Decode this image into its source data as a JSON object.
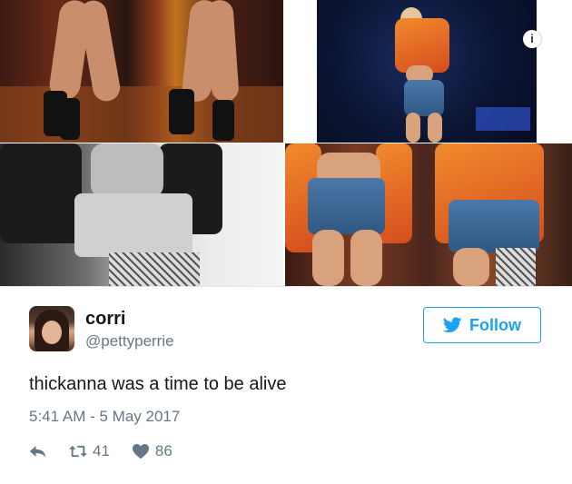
{
  "media": {
    "info_label": "i"
  },
  "tweet": {
    "display_name": "corri",
    "handle": "@pettyperrie",
    "follow_label": "Follow",
    "text": "thickanna was a time to be alive",
    "timestamp": "5:41 AM - 5 May 2017",
    "retweet_count": "41",
    "like_count": "86"
  },
  "colors": {
    "accent": "#1da1f2",
    "text": "#14171a",
    "muted": "#657786"
  },
  "icons": {
    "reply": "reply-icon",
    "retweet": "retweet-icon",
    "like": "heart-icon",
    "follow": "twitter-bird-icon",
    "info": "info-icon"
  }
}
